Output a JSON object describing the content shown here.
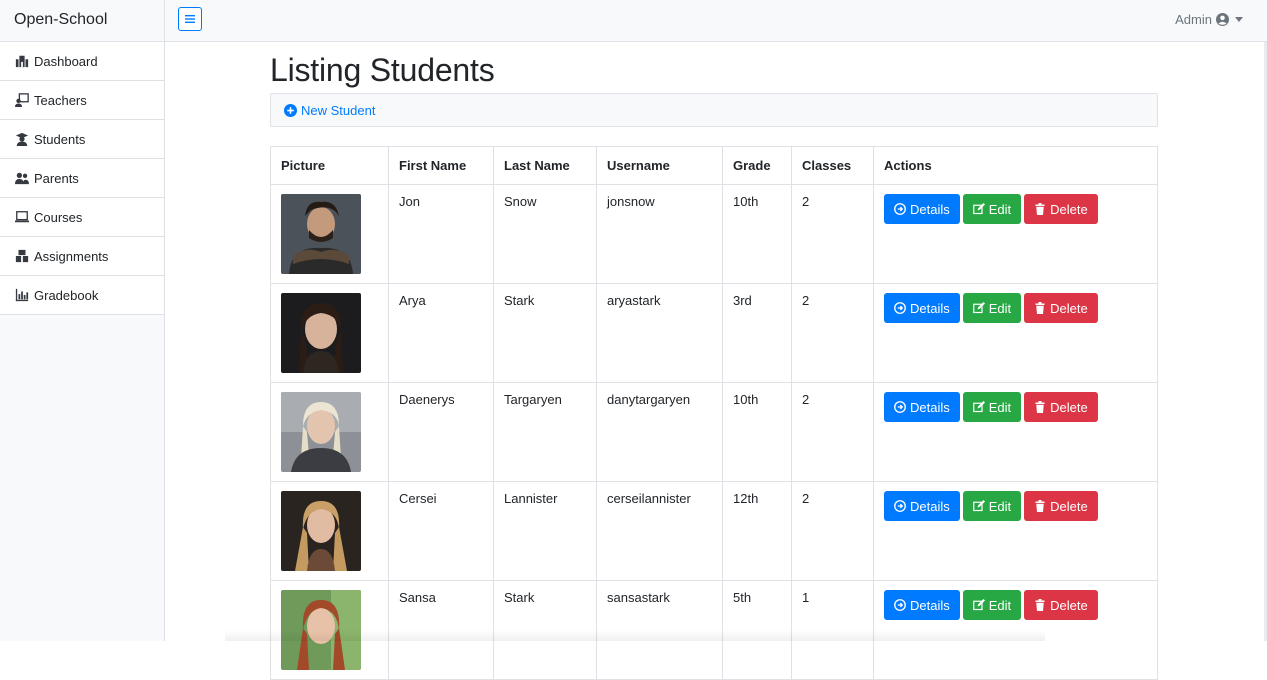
{
  "brand": "Open-School",
  "sidebar": {
    "items": [
      {
        "label": "Dashboard",
        "icon": "dashboard-icon"
      },
      {
        "label": "Teachers",
        "icon": "teacher-icon"
      },
      {
        "label": "Students",
        "icon": "student-icon"
      },
      {
        "label": "Parents",
        "icon": "parents-icon"
      },
      {
        "label": "Courses",
        "icon": "laptop-icon"
      },
      {
        "label": "Assignments",
        "icon": "assignments-icon"
      },
      {
        "label": "Gradebook",
        "icon": "chart-icon"
      }
    ]
  },
  "topbar": {
    "user_label": "Admin"
  },
  "main": {
    "title": "Listing Students",
    "new_student_label": "New Student",
    "table": {
      "headers": [
        "Picture",
        "First Name",
        "Last Name",
        "Username",
        "Grade",
        "Classes",
        "Actions"
      ],
      "rows": [
        {
          "first": "Jon",
          "last": "Snow",
          "username": "jonsnow",
          "grade": "10th",
          "classes": "2"
        },
        {
          "first": "Arya",
          "last": "Stark",
          "username": "aryastark",
          "grade": "3rd",
          "classes": "2"
        },
        {
          "first": "Daenerys",
          "last": "Targaryen",
          "username": "danytargaryen",
          "grade": "10th",
          "classes": "2"
        },
        {
          "first": "Cersei",
          "last": "Lannister",
          "username": "cerseilannister",
          "grade": "12th",
          "classes": "2"
        },
        {
          "first": "Sansa",
          "last": "Stark",
          "username": "sansastark",
          "grade": "5th",
          "classes": "1"
        }
      ]
    },
    "actions": {
      "details": "Details",
      "edit": "Edit",
      "delete": "Delete"
    }
  },
  "colors": {
    "primary": "#007bff",
    "success": "#28a745",
    "danger": "#dc3545"
  }
}
